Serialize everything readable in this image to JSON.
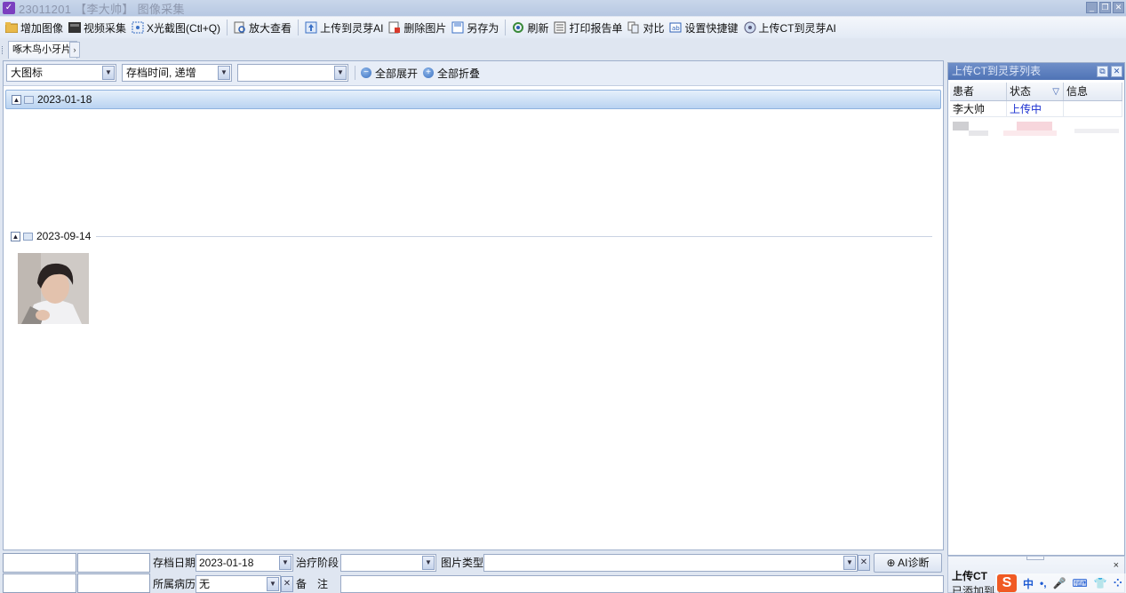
{
  "window": {
    "title": "23011201 【李大帅】 图像采集",
    "controls": [
      "_",
      "❐",
      "✕"
    ]
  },
  "toolbar": {
    "items": [
      {
        "label": "增加图像",
        "icon": "folder-add-icon"
      },
      {
        "label": "视频采集",
        "icon": "video-icon"
      },
      {
        "label": "X光截图(Ctl+Q)",
        "icon": "xray-capture-icon"
      },
      {
        "label": "放大查看",
        "icon": "zoom-view-icon"
      },
      {
        "label": "上传到灵芽AI",
        "icon": "upload-icon"
      },
      {
        "label": "删除图片",
        "icon": "delete-image-icon"
      },
      {
        "label": "另存为",
        "icon": "save-as-icon"
      },
      {
        "label": "刷新",
        "icon": "refresh-icon"
      },
      {
        "label": "打印报告单",
        "icon": "print-icon"
      },
      {
        "label": "对比",
        "icon": "compare-icon"
      },
      {
        "label": "设置快捷键",
        "icon": "shortcut-icon"
      },
      {
        "label": "上传CT到灵芽AI",
        "icon": "upload-ct-icon"
      }
    ]
  },
  "doc_tab": {
    "label": "啄木鸟小牙片",
    "nav": "›"
  },
  "filters": {
    "view_mode": "大图标",
    "sort": "存档时间, 递增",
    "third": "",
    "expand_all": "全部展开",
    "collapse_all": "全部折叠"
  },
  "groups": [
    {
      "date": "2023-01-18",
      "collapse_glyph": "▲"
    },
    {
      "date": "2023-09-14",
      "collapse_glyph": "▲"
    }
  ],
  "bottom_form": {
    "archive_date_label": "存档日期",
    "archive_date_value": "2023-01-18",
    "treatment_stage_label": "治疗阶段",
    "treatment_stage_value": "",
    "image_type_label": "图片类型",
    "image_type_value": "",
    "ai_button": "⊕ AI诊断",
    "case_label": "所属病历",
    "case_value": "无",
    "note_label": "备　注",
    "note_value": "",
    "clear": "✕"
  },
  "right_panel": {
    "title": "上传CT到灵芽列表",
    "pin": "⧉",
    "close": "✕",
    "columns": [
      "患者",
      "状态",
      "信息"
    ],
    "filter_glyph": "▽",
    "rows": [
      {
        "patient": "李大帅",
        "status": "上传中",
        "info": ""
      }
    ]
  },
  "toast": {
    "title": "上传CT",
    "message": "已添加到上传列表",
    "close": "×"
  },
  "ime": {
    "logo": "S",
    "mode": "中",
    "punct": "•,",
    "mic": "🎤",
    "keyboard": "⌨",
    "skin": "👕",
    "menu": "⁘"
  },
  "colors": {
    "accent": "#4f73b6",
    "status_uploading": "#1a2fd0"
  }
}
